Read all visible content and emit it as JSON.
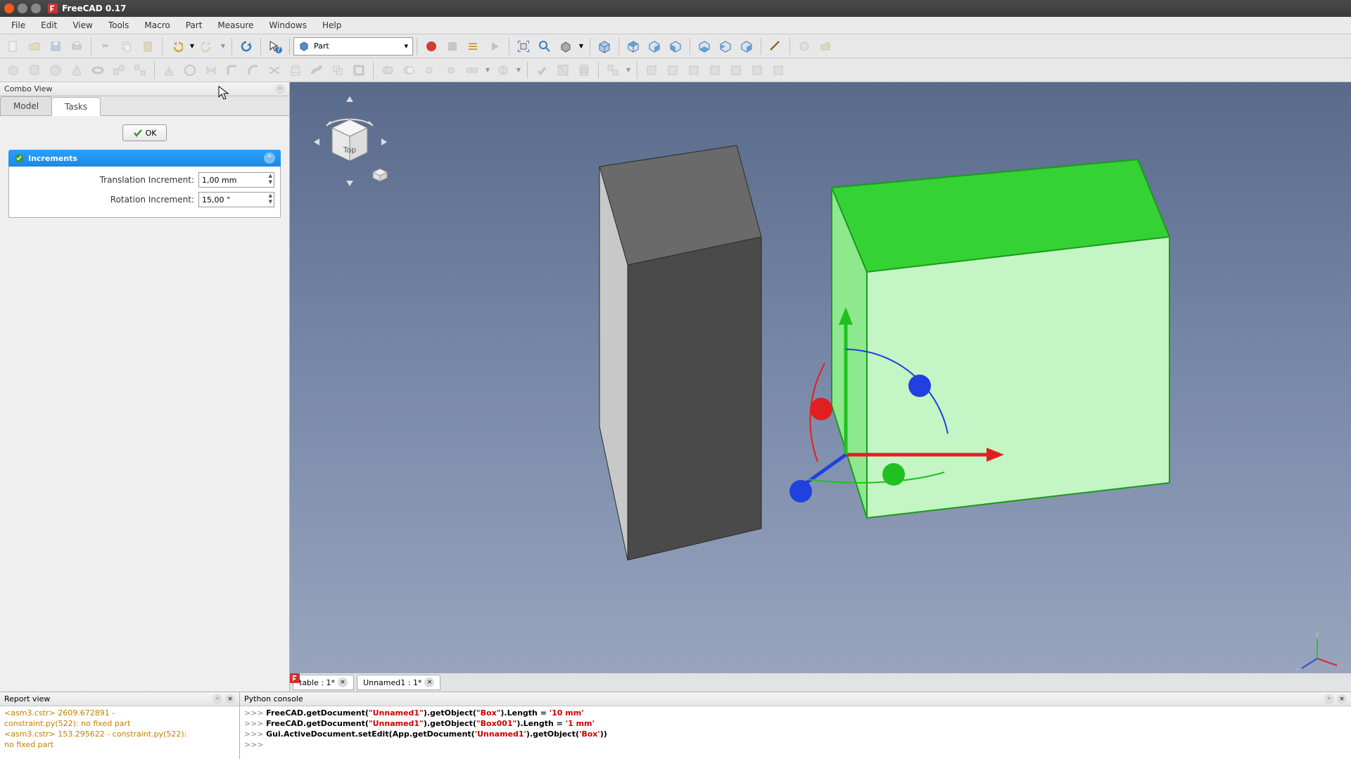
{
  "title": "FreeCAD 0.17",
  "menubar": [
    "File",
    "Edit",
    "View",
    "Tools",
    "Macro",
    "Part",
    "Measure",
    "Windows",
    "Help"
  ],
  "workbench": "Part",
  "combo": {
    "title": "Combo View",
    "tabs": {
      "model": "Model",
      "tasks": "Tasks"
    },
    "ok": "OK",
    "panel_title": "Increments",
    "trans_label": "Translation Increment:",
    "trans_value": "1,00 mm",
    "rot_label": "Rotation Increment:",
    "rot_value": "15,00 °"
  },
  "orient": "Top",
  "doctabs": [
    {
      "label": "table : 1*"
    },
    {
      "label": "Unnamed1 : 1*"
    }
  ],
  "report": {
    "title": "Report view",
    "lines": [
      "<asm3.cstr> 2609.672891 - ",
      "constraint.py(522): no fixed part",
      "<asm3.cstr> 153.295622 - constraint.py(522): ",
      "no fixed part"
    ]
  },
  "pyconsole": {
    "title": "Python console",
    "lines": [
      {
        "prompt": ">>> ",
        "plain": "FreeCAD.getDocument(",
        "s1": "\"Unnamed1\"",
        "p2": ").getObject(",
        "s2": "\"Box\"",
        "p3": ").Length = ",
        "n": "'10 mm'"
      },
      {
        "prompt": ">>> ",
        "plain": "FreeCAD.getDocument(",
        "s1": "\"Unnamed1\"",
        "p2": ").getObject(",
        "s2": "\"Box001\"",
        "p3": ").Length = ",
        "n": "'1 mm'"
      },
      {
        "prompt": ">>> ",
        "plain": "Gui.ActiveDocument.setEdit(App.getDocument(",
        "s1": "'Unnamed1'",
        "p2": ").getObject(",
        "s2": "'Box'",
        "p3": "))",
        "n": ""
      },
      {
        "prompt": ">>> ",
        "plain": "",
        "s1": "",
        "p2": "",
        "s2": "",
        "p3": "",
        "n": ""
      }
    ]
  }
}
